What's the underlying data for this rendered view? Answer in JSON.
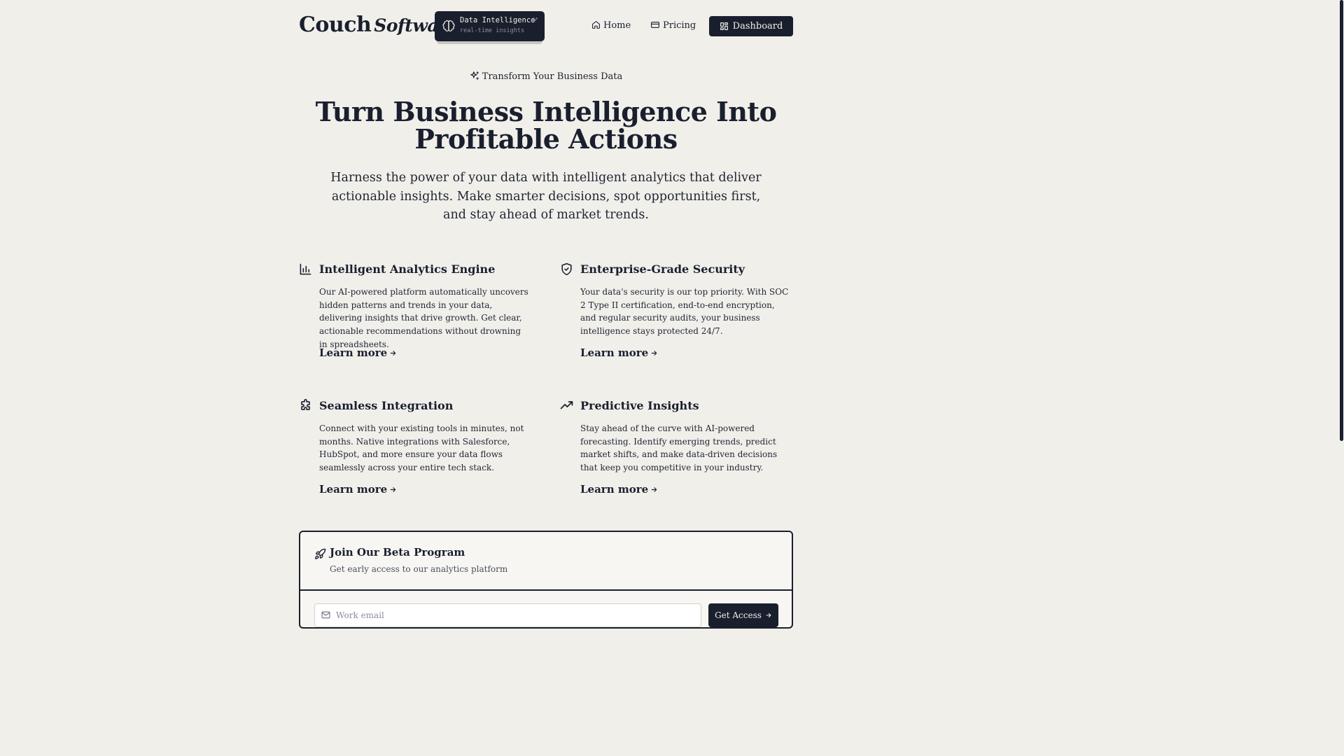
{
  "header": {
    "logo_main": "Couch",
    "logo_italic": "Software",
    "badge_title": "Data Intelligence",
    "badge_subtitle": "real-time insights",
    "nav": [
      {
        "label": "Home",
        "icon": "home-icon"
      },
      {
        "label": "Pricing",
        "icon": "credit-card-icon"
      }
    ],
    "dashboard_label": "Dashboard"
  },
  "hero": {
    "eyebrow": "Transform Your Business Data",
    "title_line1": "Turn Business Intelligence Into",
    "title_line2": "Profitable Actions",
    "subtitle": "Harness the power of your data with intelligent analytics that deliver actionable insights. Make smarter decisions, spot opportunities first, and stay ahead of market trends."
  },
  "features": [
    {
      "icon": "bar-chart-icon",
      "title": "Intelligent Analytics Engine",
      "description": "Our AI-powered platform automatically uncovers hidden patterns and trends in your data, delivering insights that drive growth. Get clear, actionable recommendations without drowning in spreadsheets.",
      "link": "Learn more"
    },
    {
      "icon": "shield-check-icon",
      "title": "Enterprise-Grade Security",
      "description": "Your data's security is our top priority. With SOC 2 Type II certification, end-to-end encryption, and regular security audits, your business intelligence stays protected 24/7.",
      "link": "Learn more"
    },
    {
      "icon": "puzzle-icon",
      "title": "Seamless Integration",
      "description": "Connect with your existing tools in minutes, not months. Native integrations with Salesforce, HubSpot, and more ensure your data flows seamlessly across your entire tech stack.",
      "link": "Learn more"
    },
    {
      "icon": "trending-up-icon",
      "title": "Predictive Insights",
      "description": "Stay ahead of the curve with AI-powered forecasting. Identify emerging trends, predict market shifts, and make data-driven decisions that keep you competitive in your industry.",
      "link": "Learn more"
    }
  ],
  "beta": {
    "title": "Join Our Beta Program",
    "subtitle": "Get early access to our analytics platform",
    "email_placeholder": "Work email",
    "button_label": "Get Access"
  },
  "colors": {
    "background": "#f1efea",
    "primary": "#1a1f2e"
  }
}
